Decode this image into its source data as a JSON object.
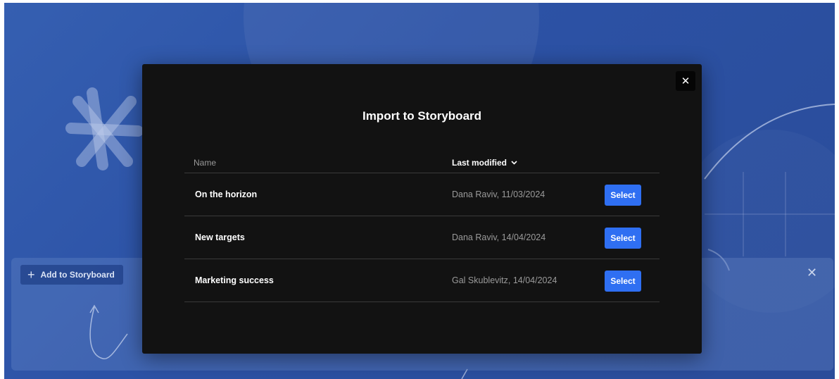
{
  "background": {
    "toolbar": {
      "add_label": "Add to Storyboard",
      "add_icon": "plus-icon",
      "close_icon": "close-icon",
      "close_glyph": "✕"
    }
  },
  "modal": {
    "title": "Import to Storyboard",
    "close_glyph": "✕",
    "columns": {
      "name": "Name",
      "modified": "Last modified",
      "sort_glyph": "⌄"
    },
    "rows": [
      {
        "name": "On the horizon",
        "modified": "Dana Raviv, 11/03/2024",
        "action": "Select"
      },
      {
        "name": "New targets",
        "modified": "Dana Raviv, 14/04/2024",
        "action": "Select"
      },
      {
        "name": "Marketing success",
        "modified": "Gal Skublevitz, 14/04/2024",
        "action": "Select"
      }
    ]
  },
  "colors": {
    "accent": "#2f6ff2",
    "modal_bg": "#121212",
    "background": "#2c52a6"
  }
}
